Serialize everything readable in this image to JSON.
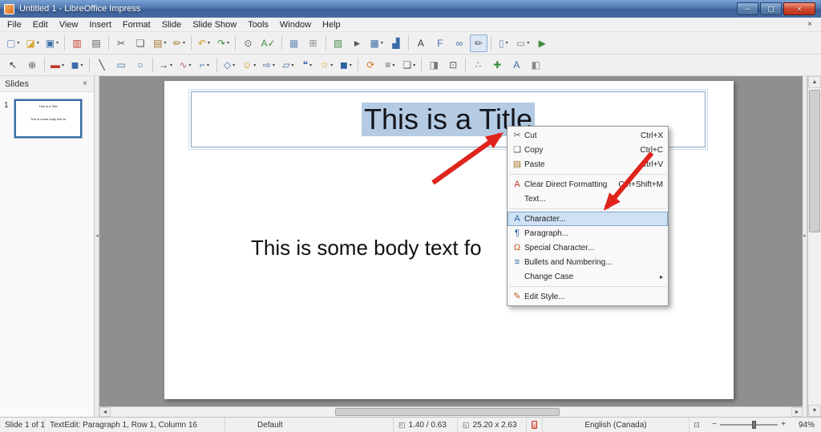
{
  "window": {
    "title": "Untitled 1 - LibreOffice Impress",
    "controls": {
      "minimize": "─",
      "maximize": "▢",
      "close": "×"
    }
  },
  "menubar": {
    "items": [
      "File",
      "Edit",
      "View",
      "Insert",
      "Format",
      "Slide",
      "Slide Show",
      "Tools",
      "Window",
      "Help"
    ],
    "close_document": "×"
  },
  "toolbars": {
    "standard": [
      {
        "name": "new-document",
        "glyph": "▢",
        "color": "#6c8fbe",
        "dropdown": true
      },
      {
        "name": "open-file",
        "glyph": "◪",
        "color": "#d8a43c",
        "dropdown": true
      },
      {
        "name": "save",
        "glyph": "▣",
        "color": "#3c6ca8",
        "dropdown": true
      },
      {
        "sep": true
      },
      {
        "name": "export-pdf",
        "glyph": "▥",
        "color": "#c0392b"
      },
      {
        "name": "print",
        "glyph": "▤",
        "color": "#5a5a5a"
      },
      {
        "sep": true
      },
      {
        "name": "cut",
        "glyph": "✂",
        "color": "#5a5a5a"
      },
      {
        "name": "copy",
        "glyph": "❏",
        "color": "#5a5a5a"
      },
      {
        "name": "paste",
        "glyph": "▤",
        "color": "#a5702c",
        "dropdown": true
      },
      {
        "name": "clone-formatting",
        "glyph": "✏",
        "color": "#a5702c",
        "dropdown": true
      },
      {
        "sep": true
      },
      {
        "name": "undo",
        "glyph": "↶",
        "color": "#d09a1c",
        "dropdown": true
      },
      {
        "name": "redo",
        "glyph": "↷",
        "color": "#3f8f3f",
        "dropdown": true
      },
      {
        "sep": true
      },
      {
        "name": "find-replace",
        "glyph": "⊙",
        "color": "#5a5a5a"
      },
      {
        "name": "spelling",
        "glyph": "A✓",
        "color": "#3f8f3f"
      },
      {
        "sep": true
      },
      {
        "name": "display-grid",
        "glyph": "▦",
        "color": "#6c8fbe"
      },
      {
        "name": "snap-guides",
        "glyph": "⊞",
        "color": "#888888"
      },
      {
        "sep": true
      },
      {
        "name": "insert-image",
        "glyph": "▧",
        "color": "#4e8f4e"
      },
      {
        "name": "insert-media",
        "glyph": "►",
        "color": "#5a5a5a"
      },
      {
        "name": "insert-table",
        "glyph": "▦",
        "color": "#3c6ca8",
        "dropdown": true
      },
      {
        "name": "insert-chart",
        "glyph": "▟",
        "color": "#3c6ca8"
      },
      {
        "sep": true
      },
      {
        "name": "insert-text-box",
        "glyph": "A",
        "color": "#333333"
      },
      {
        "name": "fontwork",
        "glyph": "F",
        "color": "#3c6ca8"
      },
      {
        "name": "hyperlink",
        "glyph": "∞",
        "color": "#3c6ca8"
      },
      {
        "name": "show-draw-functions",
        "glyph": "✏",
        "color": "#5a5a5a",
        "active": true
      },
      {
        "sep": true
      },
      {
        "name": "new-slide",
        "glyph": "▯",
        "color": "#6c8fbe",
        "dropdown": true
      },
      {
        "name": "slide-layout",
        "glyph": "▭",
        "color": "#888888",
        "dropdown": true
      },
      {
        "name": "start-slideshow",
        "glyph": "▶",
        "color": "#3f8f3f"
      }
    ],
    "drawing": [
      {
        "name": "select",
        "glyph": "↖",
        "color": "#333333"
      },
      {
        "name": "zoom",
        "glyph": "⊕",
        "color": "#5a5a5a"
      },
      {
        "sep": true
      },
      {
        "name": "line-color",
        "glyph": "▬",
        "color": "#c0392b",
        "dropdown": true
      },
      {
        "name": "fill-color",
        "glyph": "◼",
        "color": "#3c6ca8",
        "dropdown": true
      },
      {
        "sep": true
      },
      {
        "name": "insert-line",
        "glyph": "╲",
        "color": "#333333"
      },
      {
        "name": "rectangle",
        "glyph": "▭",
        "color": "#3c6ca8"
      },
      {
        "name": "ellipse",
        "glyph": "○",
        "color": "#3c6ca8"
      },
      {
        "sep": true
      },
      {
        "name": "lines-and-arrows",
        "glyph": "→",
        "color": "#333333",
        "dropdown": true
      },
      {
        "name": "curve",
        "glyph": "∿",
        "color": "#b05fa0",
        "dropdown": true
      },
      {
        "name": "connectors",
        "glyph": "⌐",
        "color": "#3c6ca8",
        "dropdown": true
      },
      {
        "sep": true
      },
      {
        "name": "basic-shapes",
        "glyph": "◇",
        "color": "#3c6ca8",
        "dropdown": true
      },
      {
        "name": "symbol-shapes",
        "glyph": "☺",
        "color": "#d8a01e",
        "dropdown": true
      },
      {
        "name": "block-arrows",
        "glyph": "⇨",
        "color": "#3c6ca8",
        "dropdown": true
      },
      {
        "name": "flowchart-shapes",
        "glyph": "▱",
        "color": "#3c6ca8",
        "dropdown": true
      },
      {
        "name": "callout-shapes",
        "glyph": "❝",
        "color": "#3c6ca8",
        "dropdown": true
      },
      {
        "name": "star-shapes",
        "glyph": "☆",
        "color": "#d8a01e",
        "dropdown": true
      },
      {
        "name": "3d-objects",
        "glyph": "◼",
        "color": "#2d5f9e",
        "dropdown": true
      },
      {
        "sep": true
      },
      {
        "name": "rotate",
        "glyph": "⟳",
        "color": "#d8721e"
      },
      {
        "name": "align-objects",
        "glyph": "≡",
        "color": "#5a5a5a",
        "dropdown": true
      },
      {
        "name": "arrange",
        "glyph": "❏",
        "color": "#5a5a5a",
        "dropdown": true
      },
      {
        "sep": true
      },
      {
        "name": "shadow",
        "glyph": "◨",
        "color": "#777777"
      },
      {
        "name": "crop-image",
        "glyph": "⊡",
        "color": "#5a5a5a"
      },
      {
        "sep": true
      },
      {
        "name": "edit-points",
        "glyph": "∴",
        "color": "#3c6ca8"
      },
      {
        "name": "glue-points",
        "glyph": "✚",
        "color": "#3f8f3f"
      },
      {
        "name": "fontwork-gallery",
        "glyph": "A",
        "color": "#3c6ca8"
      },
      {
        "name": "extrusion-toggle",
        "glyph": "◧",
        "color": "#888888"
      }
    ]
  },
  "slides_panel": {
    "title": "Slides",
    "close": "×",
    "slide_number": "1"
  },
  "slide": {
    "title_text": "This is a Title",
    "body_text": "This is some body text fo"
  },
  "context_menu": {
    "items": [
      {
        "label": "Cut",
        "shortcut": "Ctrl+X",
        "icon": "✂",
        "icon_style": "color:#5a5a5a"
      },
      {
        "label": "Copy",
        "shortcut": "Ctrl+C",
        "icon": "❏",
        "icon_style": "color:#5a5a5a"
      },
      {
        "label": "Paste",
        "shortcut": "Ctrl+V",
        "icon": "▤",
        "icon_style": "color:#a5702c"
      },
      {
        "label": "Clear Direct Formatting",
        "shortcut": "Ctrl+Shift+M",
        "icon": "A",
        "icon_style": "color:#c0392b"
      },
      {
        "label": "Text..."
      },
      {
        "label": "Character...",
        "icon": "A",
        "icon_style": "color:#2d5f9e"
      },
      {
        "label": "Paragraph...",
        "icon": "¶",
        "icon_style": "color:#2d5f9e"
      },
      {
        "label": "Special Character...",
        "icon": "Ω",
        "icon_style": "color:#c2571a"
      },
      {
        "label": "Bullets and Numbering...",
        "icon": "≡",
        "icon_style": "color:#2d5f9e"
      },
      {
        "label": "Change Case"
      },
      {
        "label": "Edit Style...",
        "icon": "✎",
        "icon_style": "color:#c2571a"
      }
    ],
    "submenu_arrow": "▸"
  },
  "status_bar": {
    "slide_info": "Slide 1 of 1",
    "edit_info": "TextEdit: Paragraph 1, Row 1, Column 16",
    "style_name": "Default",
    "position": "1.40 / 0.63",
    "size": "25.20 x 2.63",
    "language": "English (Canada)",
    "zoom_out": "−",
    "zoom_in": "+",
    "zoom_percent": "94%"
  },
  "icons": {
    "scroll_up": "▲",
    "scroll_down": "▼",
    "scroll_left": "◄",
    "scroll_right": "►",
    "collapse_left": "◂",
    "collapse_right": "▸",
    "position": "◰",
    "size": "◱",
    "zoom_fit": "⊡"
  },
  "annotations": {
    "arrow_color": "#e0241c"
  }
}
